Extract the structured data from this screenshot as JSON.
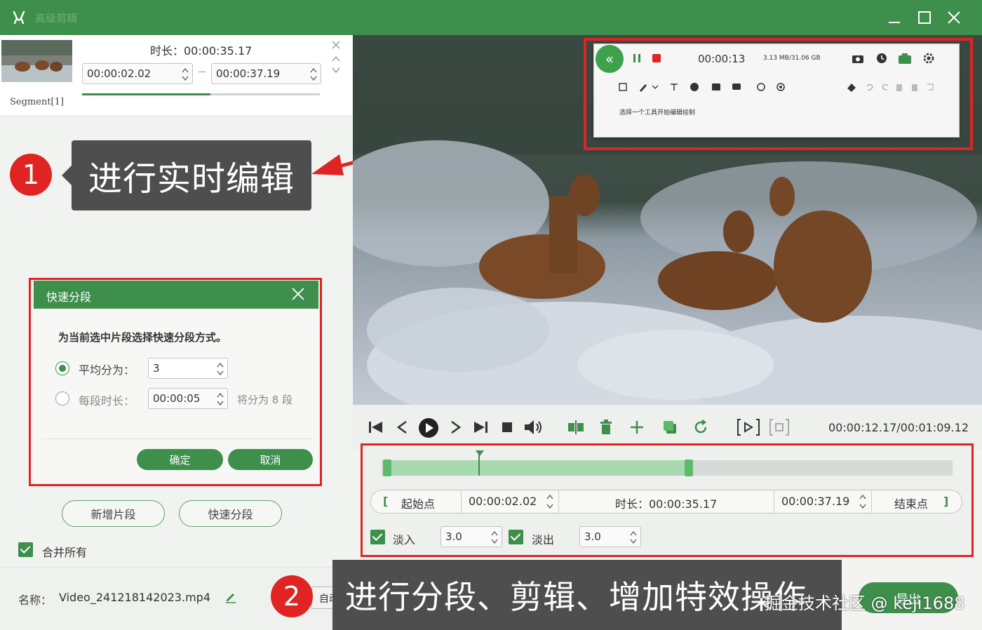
{
  "app": {
    "title": "高级剪辑"
  },
  "segment": {
    "label": "Segment[1]",
    "duration_label": "时长：00:00:35.17",
    "start": "00:00:02.02",
    "end": "00:00:37.19"
  },
  "annotations": {
    "one": {
      "number": "1",
      "text": "进行实时编辑"
    },
    "two": {
      "number": "2",
      "text": "进行分段、剪辑、增加特效操作"
    }
  },
  "quick_split": {
    "title": "快速分段",
    "prompt": "为当前选中片段选择快速分段方式。",
    "option_avg_label": "平均分为：",
    "option_avg_value": "3",
    "option_len_label": "每段时长：",
    "option_len_value": "00:00:05",
    "option_len_result": "将分为 8 段",
    "ok": "确定",
    "cancel": "取消"
  },
  "actions": {
    "add_segment": "新增片段",
    "quick_split": "快速分段",
    "merge_all": "合并所有"
  },
  "file": {
    "name_label": "名称：",
    "name_value": "Video_241218142023.mp4",
    "auto_tab": "自动"
  },
  "recorder": {
    "time": "00:00:13",
    "size": "3.13 MB/31.06 GB",
    "hint": "选择一个工具开始编辑绘制"
  },
  "player": {
    "time": "00:00:12.17/00:01:09.12"
  },
  "timeline": {
    "start_label": "起始点",
    "start_value": "00:00:02.02",
    "duration": "时长：00:00:35.17",
    "end_value": "00:00:37.19",
    "end_label": "结束点",
    "fade_in_label": "淡入",
    "fade_in_value": "3.0",
    "fade_out_label": "淡出",
    "fade_out_value": "3.0",
    "selection_fraction": [
      0.005,
      0.54
    ],
    "playhead_fraction": 0.17
  },
  "export": {
    "label": "导出"
  },
  "watermark": "掘金技术社区 @ keji1688",
  "colors": {
    "brand_green": "#3e8e4c",
    "annotation_red": "#e02424",
    "callout_gray": "#4e4e4e"
  }
}
